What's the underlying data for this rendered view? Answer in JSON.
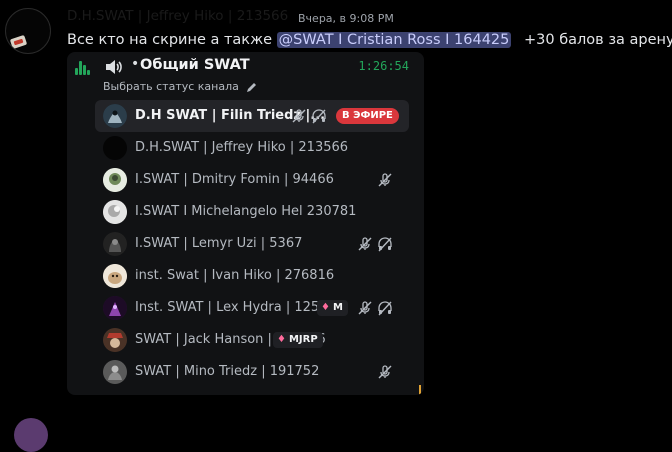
{
  "message": {
    "author": "D.H.SWAT | Jeffrey Hiko | 213566",
    "timestamp": "Вчера, в 9:08 PM",
    "text_before": "Все кто на скрине а также",
    "mention": "@SWAT I Cristian Ross I 164425",
    "text_after": "+30 балов за арену"
  },
  "voice_channel": {
    "name": "Общий SWAT",
    "separator": "•",
    "timer": "1:26:54",
    "status_placeholder": "Выбрать статус канала",
    "accent_green": "#23a55a",
    "live_color": "#da373c",
    "members": [
      {
        "name": "D.H SWAT | Filin Triedz |...",
        "active": true,
        "live": "В ЭФИРЕ",
        "icons": [
          "muted-mic-icon",
          "deafened-headphones-icon"
        ]
      },
      {
        "name": "D.H.SWAT | Jeffrey Hiko | 213566",
        "icons": []
      },
      {
        "name": "I.SWAT | Dmitry Fomin | 94466",
        "icons": [
          "muted-mic-icon"
        ]
      },
      {
        "name": "I.SWAT I Michelangelo Hel 230781",
        "icons": []
      },
      {
        "name": "I.SWAT | Lemyr Uzi | 5367",
        "icons": [
          "muted-mic-icon",
          "deafened-headphones-icon"
        ]
      },
      {
        "name": "inst. Swat | Ivan Hiko | 276816",
        "icons": []
      },
      {
        "name": "Inst. SWAT | Lex Hydra | 125833",
        "badge": "M",
        "icons": [
          "muted-mic-icon",
          "deafened-headphones-icon"
        ]
      },
      {
        "name": "SWAT | Jack Hanson | 281666",
        "badge": "MJRP",
        "icons": []
      },
      {
        "name": "SWAT | Mino Triedz | 191752",
        "icons": [
          "muted-mic-icon"
        ]
      }
    ]
  }
}
